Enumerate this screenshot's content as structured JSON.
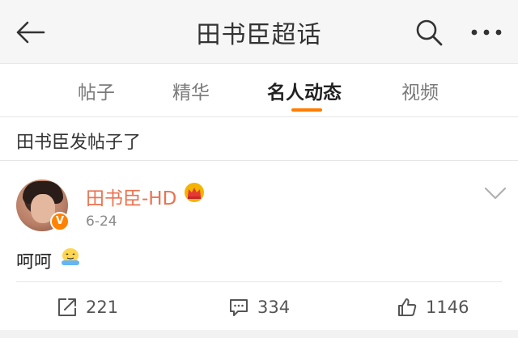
{
  "header": {
    "title": "田书臣超话"
  },
  "tabs": [
    {
      "label": "帖子"
    },
    {
      "label": "精华"
    },
    {
      "label": "名人动态"
    },
    {
      "label": "视频"
    }
  ],
  "active_tab": "名人动态",
  "notice": "田书臣发帖子了",
  "post": {
    "author": "田书臣-HD",
    "date": "6-24",
    "content": "呵呵",
    "avatar_badge": "V",
    "share_count": "221",
    "comment_count": "334",
    "like_count": "1146"
  },
  "colors": {
    "accent": "#ff7d00",
    "author_name": "#eb7350",
    "topbar_bg": "#f6f6f6"
  }
}
